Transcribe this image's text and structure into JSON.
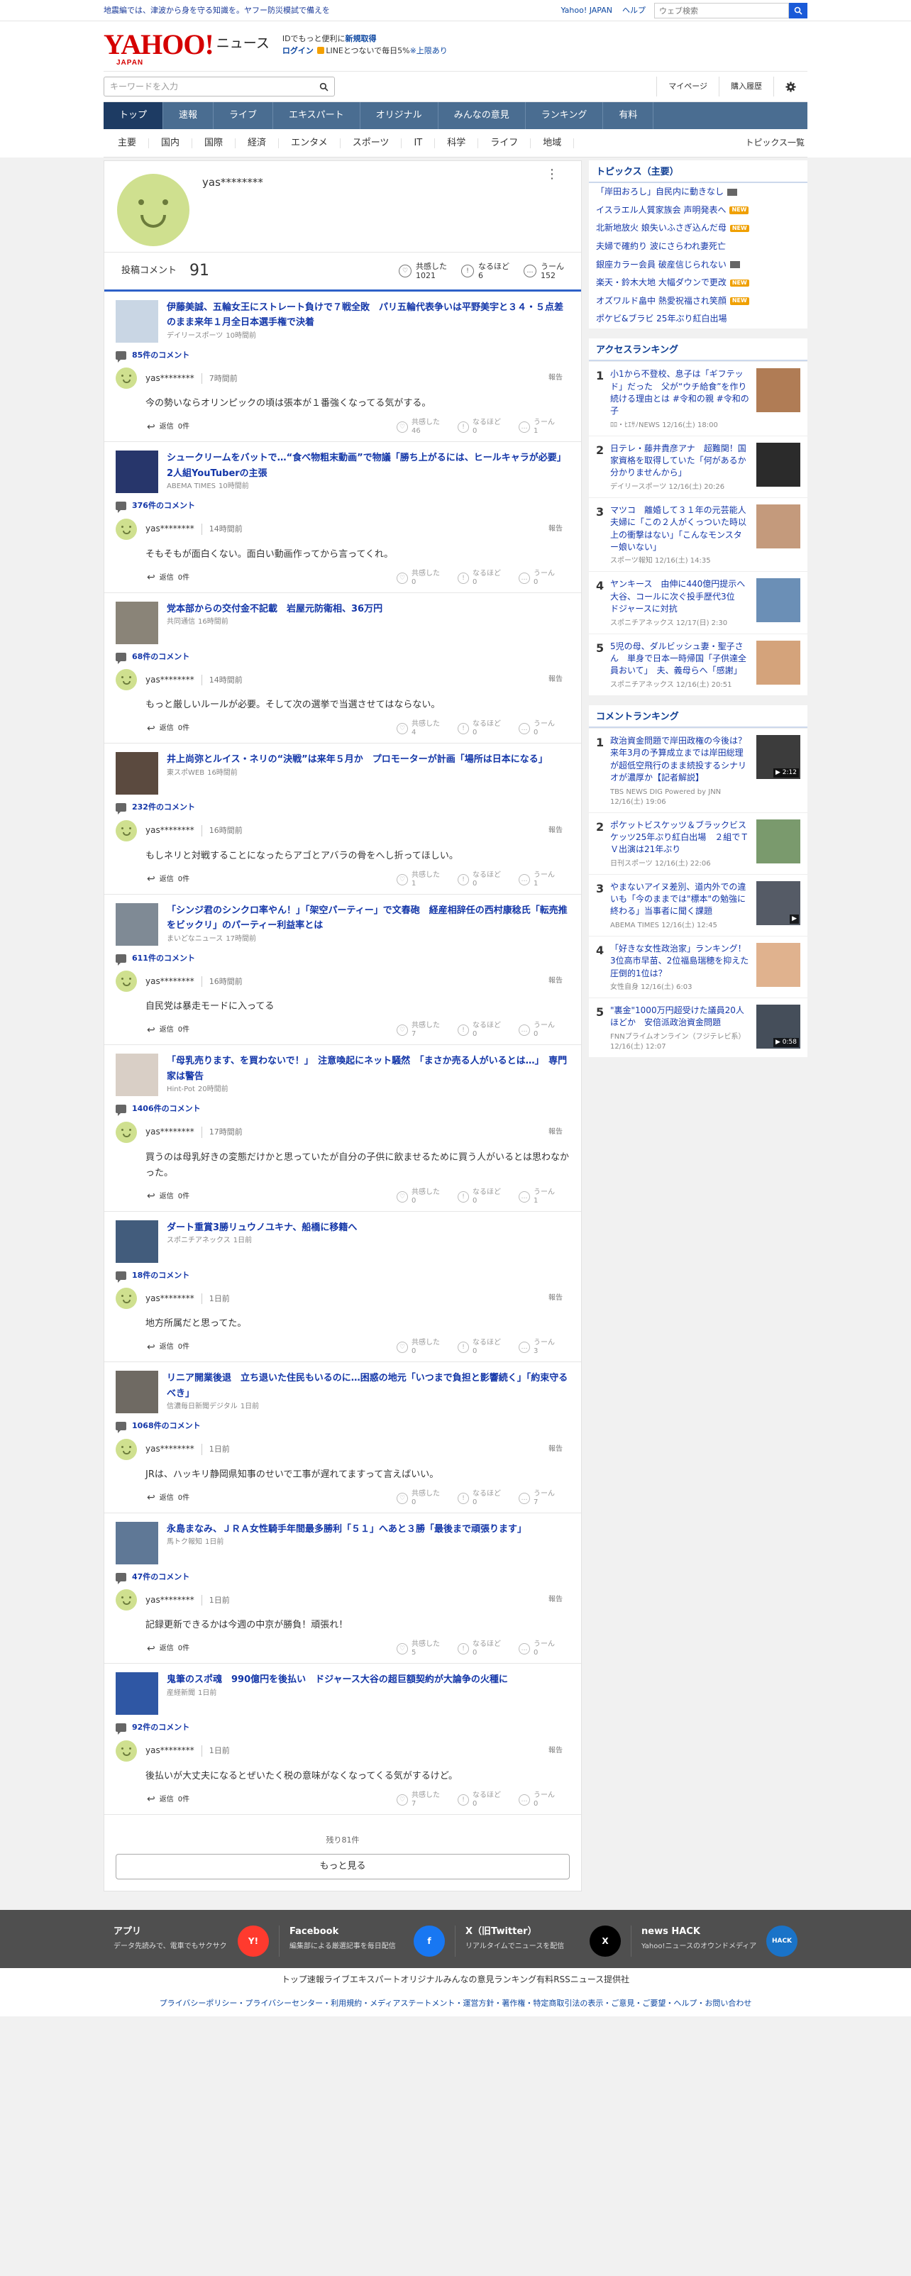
{
  "topbar": {
    "alert": "地震編では、津波から身を守る知識を。ヤフー防災模試で備えを",
    "links": [
      "Yahoo! JAPAN",
      "ヘルプ"
    ],
    "search_placeholder": "ウェブ検索"
  },
  "header": {
    "logo": "YAHOO!",
    "logo_sub": "JAPAN",
    "logo_news": "ニュース",
    "promo_line1_pre": "IDでもっと便利に",
    "promo_line1_link": "新規取得",
    "promo_login": "ログイン",
    "promo_line2": "LINEとつないで毎日5%",
    "promo_limit": "※上限あり",
    "keyword_placeholder": "キーワードを入力",
    "mypage": "マイページ",
    "subscribe": "購入履歴"
  },
  "nav": [
    "トップ",
    "速報",
    "ライブ",
    "エキスパート",
    "オリジナル",
    "みんなの意見",
    "ランキング",
    "有料"
  ],
  "categories": [
    "主要",
    "国内",
    "国際",
    "経済",
    "エンタメ",
    "スポーツ",
    "IT",
    "科学",
    "ライフ",
    "地域"
  ],
  "categories_all": "トピックス一覧",
  "profile": {
    "name": "yas********",
    "kebab": "⋮",
    "comment_label": "投稿コメント",
    "comment_count": "91",
    "reactions": [
      {
        "label": "共感した",
        "count": "1021",
        "icon": "♡"
      },
      {
        "label": "なるほど",
        "count": "6",
        "icon": "!"
      },
      {
        "label": "うーん",
        "count": "152",
        "icon": "…"
      }
    ]
  },
  "labels": {
    "reply": "返信",
    "report": "報告",
    "agree": "共感した",
    "insight": "なるほど",
    "hmm": "うーん"
  },
  "entries": [
    {
      "title": "伊藤美誠、五輪女王にストレート負けで７戦全敗　パリ五輪代表争いは平野美宇と３４・５点差のまま来年１月全日本選手権で決着",
      "source": "デイリースポーツ",
      "source_time": "10時間前",
      "comment_count": "85件のコメント",
      "user": "yas********",
      "time": "7時間前",
      "text": "今の勢いならオリンピックの頃は張本が１番強くなってる気がする。",
      "reply": "0件",
      "agree": "46",
      "insight": "0",
      "hmm": "1",
      "thumb": "#c9d6e4"
    },
    {
      "title": "シュークリームをバットで…“食べ物粗末動画”で物議「勝ち上がるには、ヒールキャラが必要」2人組YouTuberの主張",
      "source": "ABEMA TIMES",
      "source_time": "10時間前",
      "comment_count": "376件のコメント",
      "user": "yas********",
      "time": "14時間前",
      "text": "そもそもが面白くない。面白い動画作ってから言ってくれ。",
      "reply": "0件",
      "agree": "0",
      "insight": "0",
      "hmm": "0",
      "thumb": "#27366b"
    },
    {
      "title": "党本部からの交付金不記載　岩屋元防衛相、36万円",
      "source": "共同通信",
      "source_time": "16時間前",
      "comment_count": "68件のコメント",
      "user": "yas********",
      "time": "14時間前",
      "text": "もっと厳しいルールが必要。そして次の選挙で当選させてはならない。",
      "reply": "0件",
      "agree": "4",
      "insight": "0",
      "hmm": "0",
      "thumb": "#8a8478"
    },
    {
      "title": "井上尚弥とルイス・ネリの“決戦”は来年５月か　プロモーターが計画「場所は日本になる」",
      "source": "東スポWEB",
      "source_time": "16時間前",
      "comment_count": "232件のコメント",
      "user": "yas********",
      "time": "16時間前",
      "text": "もしネリと対戦することになったらアゴとアバラの骨をへし折ってほしい。",
      "reply": "0件",
      "agree": "1",
      "insight": "0",
      "hmm": "1",
      "thumb": "#5b4a3f"
    },
    {
      "title": "「シンジ君のシンクロ率やん！」「架空パーティー」で文春砲　経産相辞任の西村康稔氏「転売推をビックリ」のパーティー利益率とは",
      "source": "まいどなニュース",
      "source_time": "17時間前",
      "comment_count": "611件のコメント",
      "user": "yas********",
      "time": "16時間前",
      "text": "自民党は暴走モードに入ってる",
      "reply": "0件",
      "agree": "7",
      "insight": "0",
      "hmm": "0",
      "thumb": "#7f8a95"
    },
    {
      "title": "「母乳売ります、を買わないで！」　注意喚起にネット騒然　「まさか売る人がいるとは…」　専門家は警告",
      "source": "Hint-Pot",
      "source_time": "20時間前",
      "comment_count": "1406件のコメント",
      "user": "yas********",
      "time": "17時間前",
      "text": "買うのは母乳好きの変態だけかと思っていたが自分の子供に飲ませるために買う人がいるとは思わなかった。",
      "reply": "0件",
      "agree": "0",
      "insight": "0",
      "hmm": "1",
      "thumb": "#d9cfc6"
    },
    {
      "title": "ダート重賞3勝リュウノユキナ、船橋に移籍へ",
      "source": "スポニチアネックス",
      "source_time": "1日前",
      "comment_count": "18件のコメント",
      "user": "yas********",
      "time": "1日前",
      "text": "地方所属だと思ってた。",
      "reply": "0件",
      "agree": "0",
      "insight": "0",
      "hmm": "3",
      "thumb": "#425c7c"
    },
    {
      "title": "リニア開業後退　立ち退いた住民もいるのに…困惑の地元「いつまで負担と影響続く」「約束守るべき」",
      "source": "信濃毎日新聞デジタル",
      "source_time": "1日前",
      "comment_count": "1068件のコメント",
      "user": "yas********",
      "time": "1日前",
      "text": "JRは、ハッキリ静岡県知事のせいで工事が遅れてますって言えばいい。",
      "reply": "0件",
      "agree": "0",
      "insight": "0",
      "hmm": "7",
      "thumb": "#6f6a63"
    },
    {
      "title": "永島まなみ、ＪＲＡ女性騎手年間最多勝利「５１」へあと３勝「最後まで頑張ります」",
      "source": "馬トク報知",
      "source_time": "1日前",
      "comment_count": "47件のコメント",
      "user": "yas********",
      "time": "1日前",
      "text": "記録更新できるかは今週の中京が勝負！頑張れ！",
      "reply": "0件",
      "agree": "5",
      "insight": "0",
      "hmm": "0",
      "thumb": "#5f7896"
    },
    {
      "title": "鬼筆のスポ魂　990億円を後払い　ドジャース大谷の超巨額契約が大論争の火種に",
      "source": "産経新聞",
      "source_time": "1日前",
      "comment_count": "92件のコメント",
      "user": "yas********",
      "time": "1日前",
      "text": "後払いが大丈夫になるとぜいたく税の意味がなくなってくる気がするけど。",
      "reply": "0件",
      "agree": "7",
      "insight": "0",
      "hmm": "0",
      "thumb": "#2f57a4"
    }
  ],
  "remaining": "残り81件",
  "more": "もっと見る",
  "sidebar": {
    "topics_title": "トピックス（主要）",
    "topics": [
      {
        "text": "「岸田おろし」自民内に動きなし",
        "badge": "pic"
      },
      {
        "text": "イスラエル人質家族会 声明発表へ",
        "badge": "new"
      },
      {
        "text": "北新地放火 娘失いふさぎ込んだ母",
        "badge": "new"
      },
      {
        "text": "夫婦で確約り 波にさらわれ妻死亡",
        "badge": ""
      },
      {
        "text": "銀座カラー会員 破産信じられない",
        "badge": "pic"
      },
      {
        "text": "楽天・鈴木大地 大幅ダウンで更改",
        "badge": "new"
      },
      {
        "text": "オズワルド畠中 熱愛祝福され笑顔",
        "badge": "new"
      },
      {
        "text": "ポケビ&ブラビ 25年ぶり紅白出場",
        "badge": ""
      }
    ],
    "new_label": "NEW",
    "access_title": "アクセスランキング",
    "access": [
      {
        "n": "1",
        "title": "小1から不登校、息子は「ギフテッド」だった　父が“ウチ給食”を作り続ける理由とは #令和の親 #令和の子",
        "src": "ﾛﾛ・ﾋｴｻﾉNEWS 12/16(土) 18:00",
        "color": "#b07c55"
      },
      {
        "n": "2",
        "title": "日テレ・藤井貴彦アナ　超難関！国家資格を取得していた「何があるか分かりませんから」",
        "src": "デイリースポーツ 12/16(土) 20:26",
        "color": "#2b2b2b"
      },
      {
        "n": "3",
        "title": "マツコ　離婚して３１年の元芸能人夫婦に「この２人がくっついた時以上の衝撃はない」「こんなモンスター娘いない」",
        "src": "スポーツ報知 12/16(土) 14:35",
        "color": "#c49a7c"
      },
      {
        "n": "4",
        "title": "ヤンキース　由伸に440億円提示へ　大谷、コールに次ぐ投手歴代3位　ドジャースに対抗",
        "src": "スポニチアネックス 12/17(日) 2:30",
        "color": "#6b8fb6"
      },
      {
        "n": "5",
        "title": "5児の母、ダルビッシュ妻・聖子さん　単身で日本一時帰国「子供達全員おいて」　夫、義母らへ「感謝」",
        "src": "スポニチアネックス 12/16(土) 20:51",
        "color": "#d4a37b"
      }
    ],
    "comment_title": "コメントランキング",
    "comments": [
      {
        "n": "1",
        "title": "政治資金問題で岸田政権の今後は？　来年3月の予算成立までは岸田総理が超低空飛行のまま続投するシナリオが濃厚か【記者解説】",
        "src": "TBS NEWS DIG Powered by JNN 12/16(土) 19:06",
        "dur": "▶ 2:12",
        "color": "#3c3c3c"
      },
      {
        "n": "2",
        "title": "ポケットビスケッツ＆ブラックビスケッツ25年ぶり紅白出場　２組でＴＶ出演は21年ぶり",
        "src": "日刊スポーツ 12/16(土) 22:06",
        "dur": "",
        "color": "#7a9a6d"
      },
      {
        "n": "3",
        "title": "やまないアイヌ差別、道内外での違いも「今のままでは\"標本\"の勉強に終わる」当事者に聞く課題",
        "src": "ABEMA TIMES 12/16(土) 12:45",
        "dur": "▶",
        "color": "#555b66"
      },
      {
        "n": "4",
        "title": "「好きな女性政治家」ランキング！3位高市早苗、2位福島瑞穂を抑えた圧倒的1位は？",
        "src": "女性自身 12/16(土) 6:03",
        "dur": "",
        "color": "#e0b28e"
      },
      {
        "n": "5",
        "title": "\"裏金\"1000万円超受けた議員20人ほどか　安倍派政治資金問題",
        "src": "FNNプライムオンライン（フジテレビ系） 12/16(土) 12:07",
        "dur": "▶ 0:58",
        "color": "#454e5a"
      }
    ]
  },
  "footer": {
    "apps": [
      {
        "name": "アプリ",
        "desc": "データ先読みで、電車でもサクサク",
        "icon_label": "Y!",
        "color": "#ff3a2e"
      },
      {
        "name": "Facebook",
        "desc": "編集部による厳選記事を毎日配信",
        "icon_label": "f",
        "color": "#1877f2"
      },
      {
        "name": "X（旧Twitter）",
        "desc": "リアルタイムでニュースを配信",
        "icon_label": "X",
        "color": "#000000"
      },
      {
        "name": "news HACK",
        "desc": "Yahoo!ニュースのオウンドメディア",
        "icon_label": "HACK",
        "color": "#1a73c8"
      }
    ],
    "nav": [
      "トップ",
      "速報",
      "ライブ",
      "エキスパート",
      "オリジナル",
      "みんなの意見",
      "ランキング",
      "有料",
      "RSS",
      "ニュース提供社"
    ],
    "links": "プライバシーポリシー・プライバシーセンター・利用規約・メディアステートメント・運営方針・著作権・特定商取引法の表示・ご意見・ご要望・ヘルプ・お問い合わせ"
  }
}
